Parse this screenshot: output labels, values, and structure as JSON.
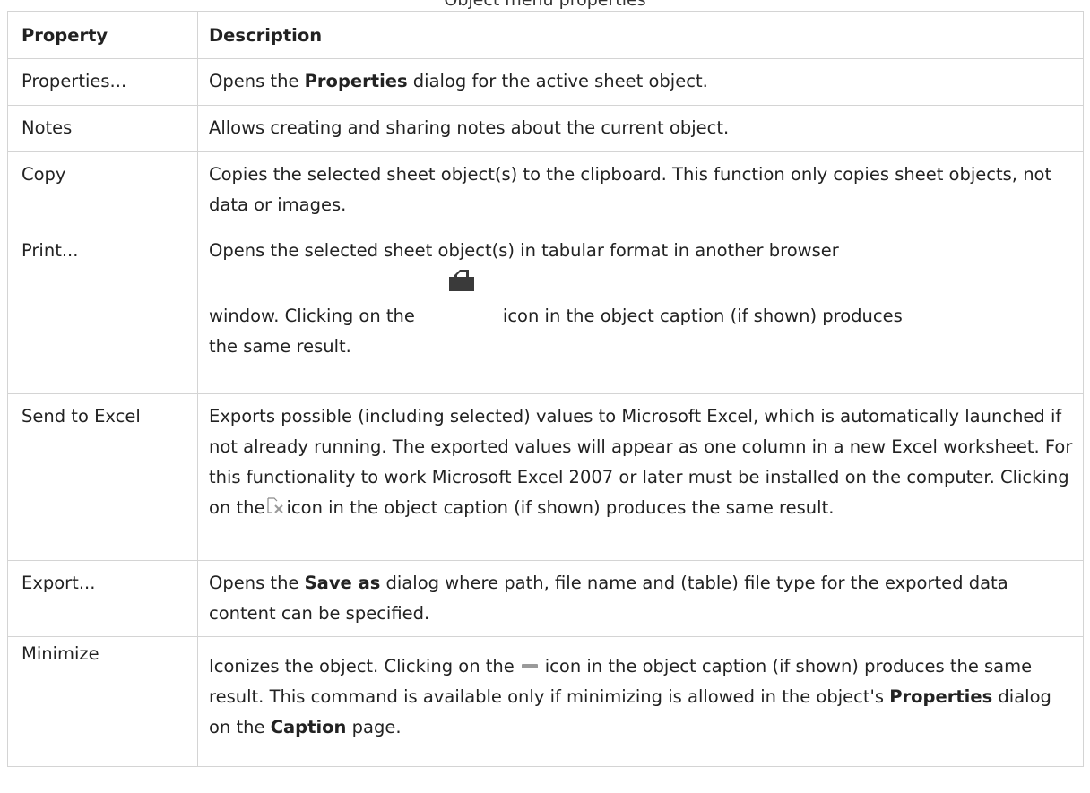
{
  "caption": "Object menu properties",
  "table": {
    "headers": {
      "property": "Property",
      "description": "Description"
    },
    "rows": {
      "properties": {
        "name": "Properties...",
        "d1": "Opens the ",
        "b1": "Properties",
        "d2": " dialog for the active sheet object."
      },
      "notes": {
        "name": "Notes",
        "d1": "Allows creating and sharing notes about the current object."
      },
      "copy": {
        "name": "Copy",
        "d1": "Copies the selected sheet object(s) to the clipboard. This function only copies sheet objects, not data or images."
      },
      "print": {
        "name": "Print...",
        "d1": "Opens the selected sheet object(s) in tabular format in another browser",
        "d2": "window. Clicking on the",
        "d3": "icon in the object caption (if shown) produces",
        "d4": "the same result.",
        "icon": "print-icon"
      },
      "send_to_excel": {
        "name": "Send to Excel",
        "d1": "Exports possible (including selected) values to Microsoft Excel, which is automatically launched if not already running. The exported values will appear as one column in a new Excel worksheet. For this functionality to work Microsoft Excel 2007 or later must be installed on the computer. Clicking on the",
        "d2": "icon in the object caption (if shown) produces the same result.",
        "icon": "excel-export-icon"
      },
      "export": {
        "name": "Export...",
        "d1": "Opens the ",
        "b1": "Save as",
        "d2": " dialog where path, file name and (table) file type for the exported data content can be specified."
      },
      "minimize": {
        "name": "Minimize",
        "d1": "Iconizes the object. Clicking on the",
        "d2": "icon in the object caption (if shown) produces the same result. This command is available only if minimizing is allowed in the object's ",
        "b1": "Properties",
        "d3": " dialog on the ",
        "b2": "Caption",
        "d4": " page.",
        "icon": "minimize-icon"
      }
    }
  }
}
